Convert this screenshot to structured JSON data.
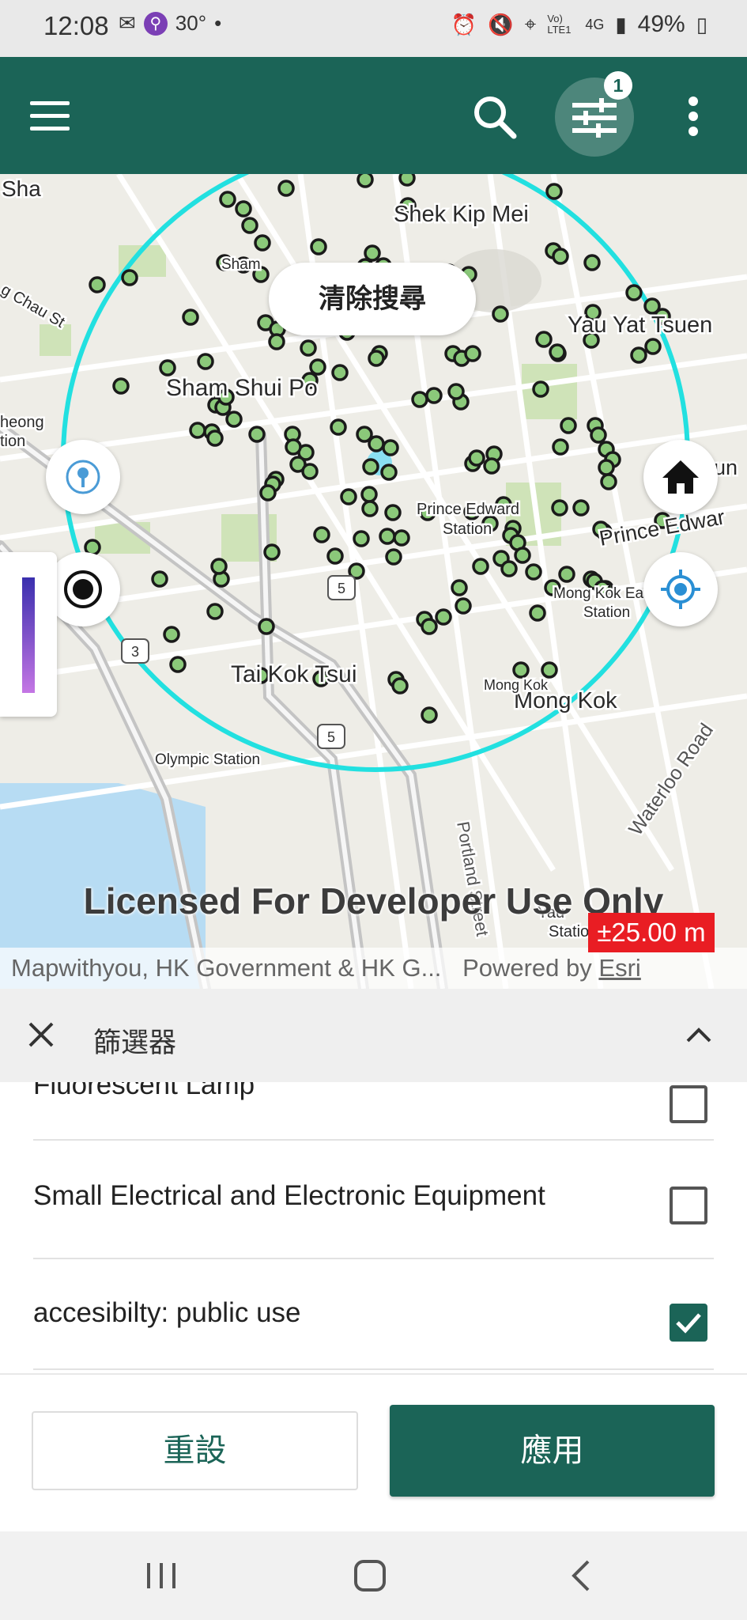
{
  "status_bar": {
    "time": "12:08",
    "temperature": "30°",
    "battery": "49%",
    "network_label": "Vo) LTE1",
    "network_type": "4G"
  },
  "app_bar": {
    "filter_badge_count": "1",
    "icons": [
      "menu-icon",
      "search-icon",
      "filter-sliders-icon",
      "more-vert-icon"
    ]
  },
  "map": {
    "clear_search_label": "清除搜尋",
    "place_labels": [
      "Sha",
      "Shek Kip Mei",
      "Sham",
      "Yau Yat Tsuen",
      "Sham Shui Po",
      "heong",
      "tion",
      "Boun",
      "Prince Edward",
      "Station",
      "Prince Edwar",
      "Mong Kok East",
      "Station",
      "Tai Kok Tsui",
      "Mong Kok",
      "Mong Kok",
      "Olympic Station",
      "Waterloo Road",
      "Portland Street",
      "Yau",
      "Station",
      "g Chau St"
    ],
    "route_shields": [
      "5",
      "3",
      "5"
    ],
    "watermark": "Licensed For Developer Use Only",
    "accuracy": "±25.00 m",
    "attribution": "Mapwithyou, HK Government & HK G...",
    "powered_by": "Powered by",
    "esri": "Esri",
    "search_radius_color": "#22e0e0",
    "marker_color": "#8bc97a"
  },
  "filter_sheet": {
    "title": "篩選器",
    "items": [
      {
        "label": "Fluorescent Lamp",
        "checked": false
      },
      {
        "label": "Small Electrical and Electronic Equipment",
        "checked": false
      },
      {
        "label": "accesibilty: public use",
        "checked": true
      }
    ],
    "reset_label": "重設",
    "apply_label": "應用"
  },
  "colors": {
    "primary": "#1b6457",
    "accuracy_bg": "#e91d23"
  }
}
